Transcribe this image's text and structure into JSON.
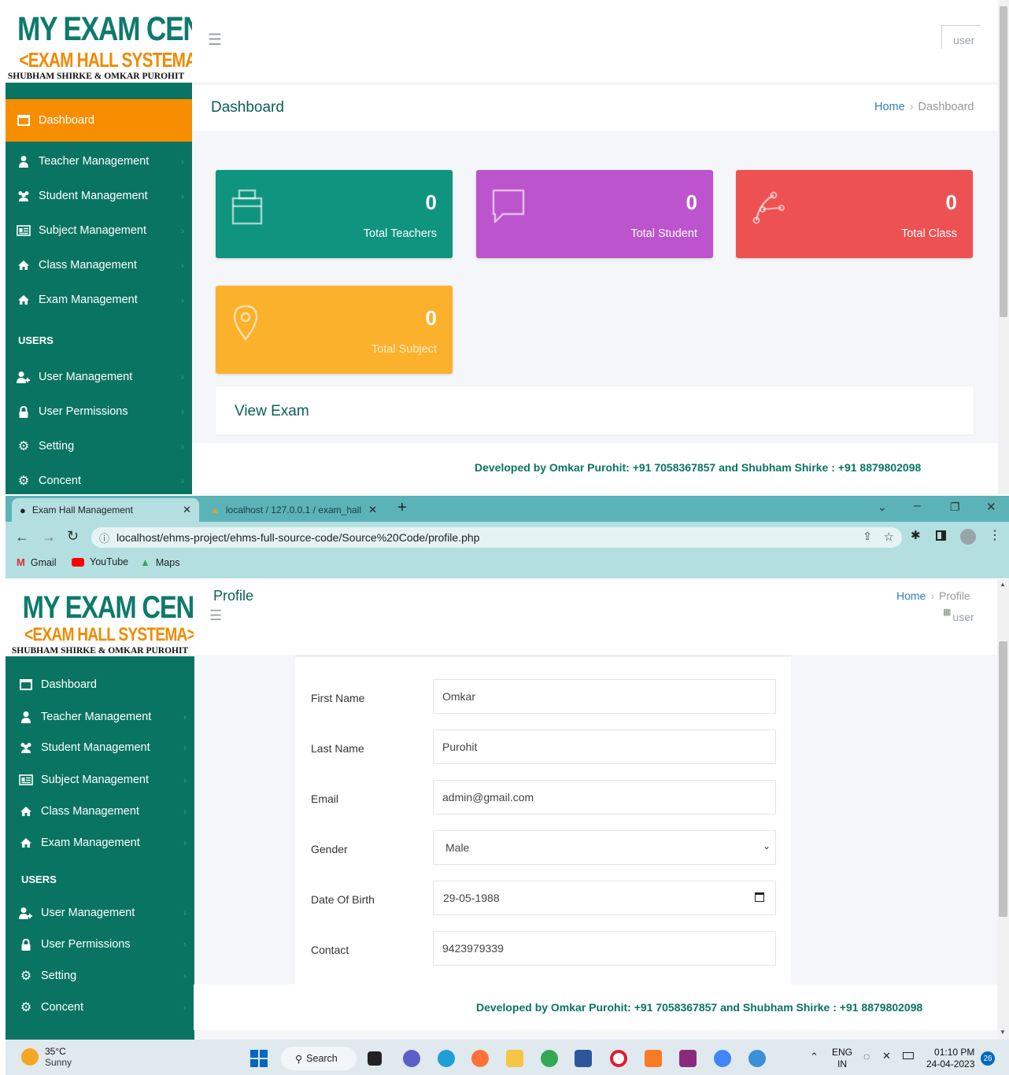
{
  "logo": {
    "line1": "MY EXAM CENTER",
    "line2": "<EXAM HALL SYSTEMA>",
    "line3": "SHUBHAM SHIRKE & OMKAR PUROHIT"
  },
  "top": {
    "user_alt": "user",
    "page_title": "Dashboard",
    "breadcrumb": {
      "home": "Home",
      "current": "Dashboard"
    },
    "sidebar": {
      "items": [
        {
          "label": "Dashboard"
        },
        {
          "label": "Teacher Management"
        },
        {
          "label": "Student Management"
        },
        {
          "label": "Subject Management"
        },
        {
          "label": "Class Management"
        },
        {
          "label": "Exam Management"
        }
      ],
      "users_heading": "USERS",
      "user_items": [
        {
          "label": "User Management"
        },
        {
          "label": "User Permissions"
        },
        {
          "label": "Setting"
        },
        {
          "label": "Concent"
        }
      ]
    },
    "cards": [
      {
        "value": "0",
        "label": "Total Teachers",
        "color": "#0f9480"
      },
      {
        "value": "0",
        "label": "Total Student",
        "color": "#bc55cd"
      },
      {
        "value": "0",
        "label": "Total Class",
        "color": "#ee5152"
      },
      {
        "value": "0",
        "label": "Total Subject",
        "color": "#fcb12c"
      }
    ],
    "view_exam": "View Exam",
    "footer": "Developed by Omkar Purohit: +91 7058367857 and Shubham Shirke : +91 8879802098"
  },
  "browser": {
    "tabs": [
      {
        "title": "Exam Hall Management"
      },
      {
        "title": "localhost / 127.0.0.1 / exam_hall"
      }
    ],
    "url": "localhost/ehms-project/ehms-full-source-code/Source%20Code/profile.php",
    "bookmarks": [
      "Gmail",
      "YouTube",
      "Maps"
    ]
  },
  "bottom": {
    "page_title": "Profile",
    "breadcrumb": {
      "home": "Home",
      "current": "Profile"
    },
    "user_alt": "user",
    "sidebar": {
      "items": [
        {
          "label": "Dashboard"
        },
        {
          "label": "Teacher Management"
        },
        {
          "label": "Student Management"
        },
        {
          "label": "Subject Management"
        },
        {
          "label": "Class Management"
        },
        {
          "label": "Exam Management"
        }
      ],
      "users_heading": "USERS",
      "user_items": [
        {
          "label": "User Management"
        },
        {
          "label": "User Permissions"
        },
        {
          "label": "Setting"
        },
        {
          "label": "Concent"
        }
      ]
    },
    "form": {
      "first_name": {
        "label": "First Name",
        "value": "Omkar"
      },
      "last_name": {
        "label": "Last Name",
        "value": "Purohit"
      },
      "email": {
        "label": "Email",
        "value": "admin@gmail.com"
      },
      "gender": {
        "label": "Gender",
        "value": "Male"
      },
      "dob": {
        "label": "Date Of Birth",
        "value": "29-05-1988"
      },
      "contact": {
        "label": "Contact",
        "value": "9423979339"
      }
    },
    "footer": "Developed by Omkar Purohit: +91 7058367857 and Shubham Shirke : +91 8879802098"
  },
  "taskbar": {
    "weather_temp": "35°C",
    "weather_desc": "Sunny",
    "search_label": "Search",
    "lang_top": "ENG",
    "lang_bottom": "IN",
    "time": "01:10 PM",
    "date": "24-04-2023",
    "badge": "26"
  }
}
